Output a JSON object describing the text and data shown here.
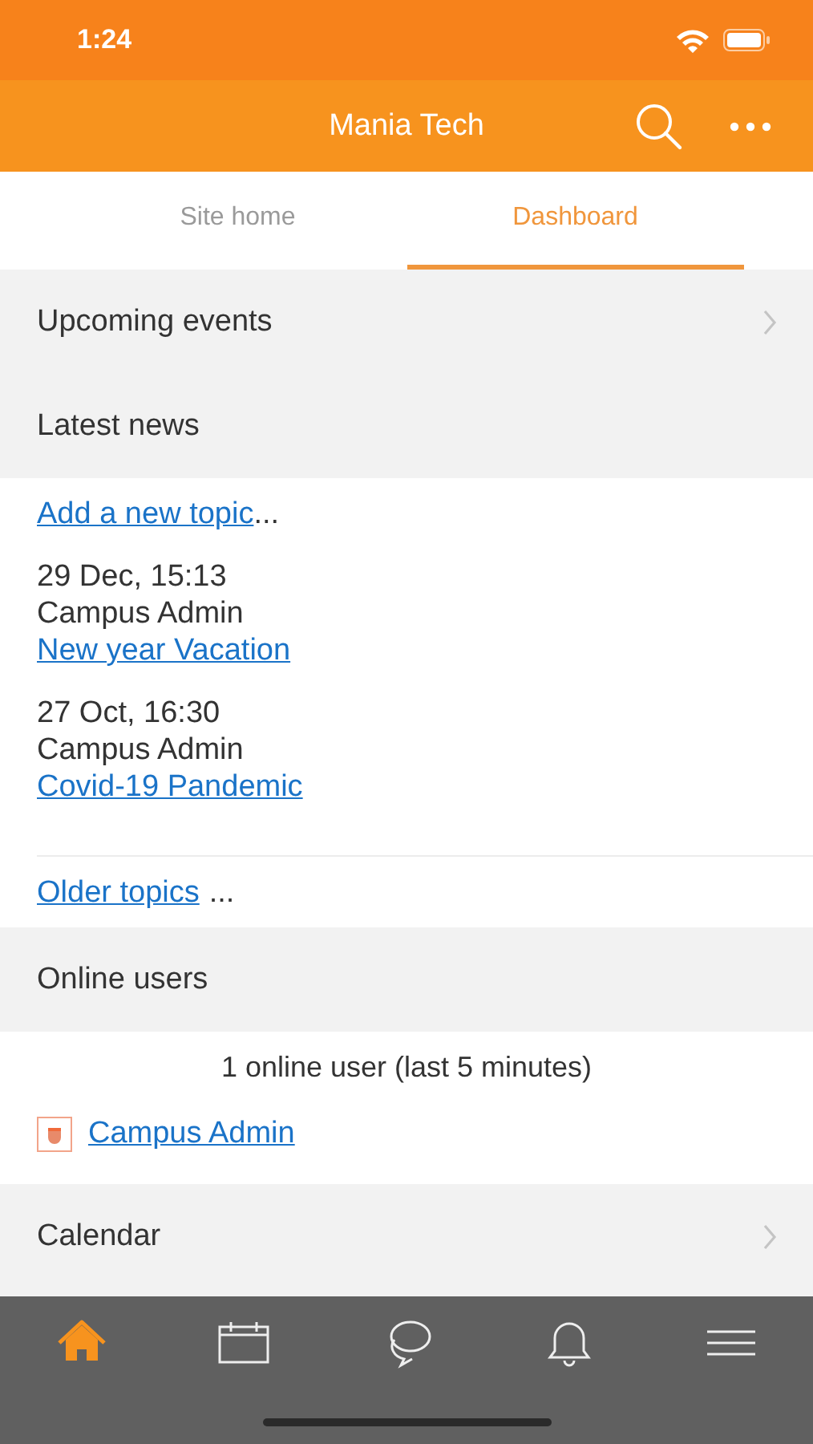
{
  "status_bar": {
    "time": "1:24"
  },
  "header": {
    "title": "Mania Tech"
  },
  "tabs": [
    {
      "label": "Site home",
      "selected": false
    },
    {
      "label": "Dashboard",
      "selected": true
    }
  ],
  "blocks": [
    {
      "kind": "link_header",
      "title": "Upcoming events"
    },
    {
      "kind": "news",
      "title": "Latest news",
      "add_link": "Add a new topic",
      "add_suffix": "...",
      "posts": [
        {
          "date": "29 Dec, 15:13",
          "author": "Campus Admin",
          "subject": "New year Vacation"
        },
        {
          "date": "27 Oct, 16:30",
          "author": "Campus Admin",
          "subject": "Covid-19 Pandemic"
        }
      ],
      "older_link": "Older topics",
      "older_suffix": "..."
    },
    {
      "kind": "users",
      "title": "Online users",
      "summary": "1 online user (last 5 minutes)",
      "users": [
        "Campus Admin"
      ]
    },
    {
      "kind": "link_header",
      "title": "Calendar"
    }
  ],
  "tab_bar": [
    {
      "kind": "home",
      "selected": true
    },
    {
      "kind": "calendar",
      "selected": false
    },
    {
      "kind": "messages",
      "selected": false
    },
    {
      "kind": "notifications",
      "selected": false
    },
    {
      "kind": "menu",
      "selected": false
    }
  ]
}
